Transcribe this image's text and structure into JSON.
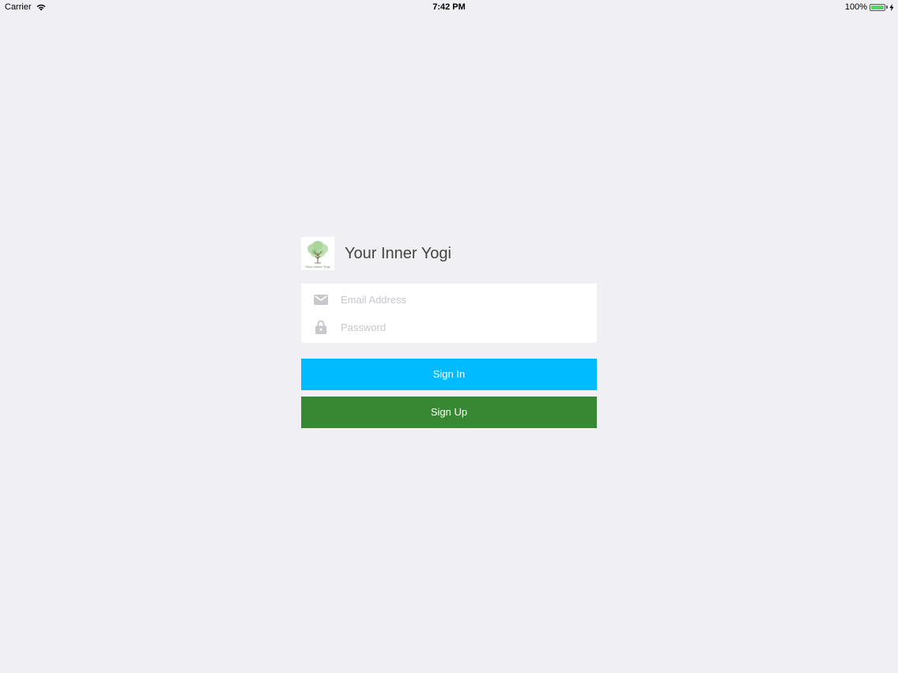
{
  "status_bar": {
    "carrier": "Carrier",
    "time": "7:42 PM",
    "battery_percent": "100%",
    "battery_level": 1.0,
    "icons": [
      "wifi-icon",
      "battery-icon",
      "charging-bolt-icon"
    ]
  },
  "login": {
    "app_title": "Your Inner Yogi",
    "logo_caption": "Your Inner Yogi",
    "logo_icon": "tree-logo-icon",
    "email_placeholder": "Email Address",
    "email_value": "",
    "email_icon": "envelope-icon",
    "password_placeholder": "Password",
    "password_value": "",
    "password_icon": "lock-icon",
    "sign_in_label": "Sign In",
    "sign_up_label": "Sign Up"
  },
  "colors": {
    "background": "#efeff4",
    "sign_in": "#00bbff",
    "sign_up": "#388833",
    "icon_gray": "#c8c8cc",
    "battery_green": "#4cd964"
  }
}
